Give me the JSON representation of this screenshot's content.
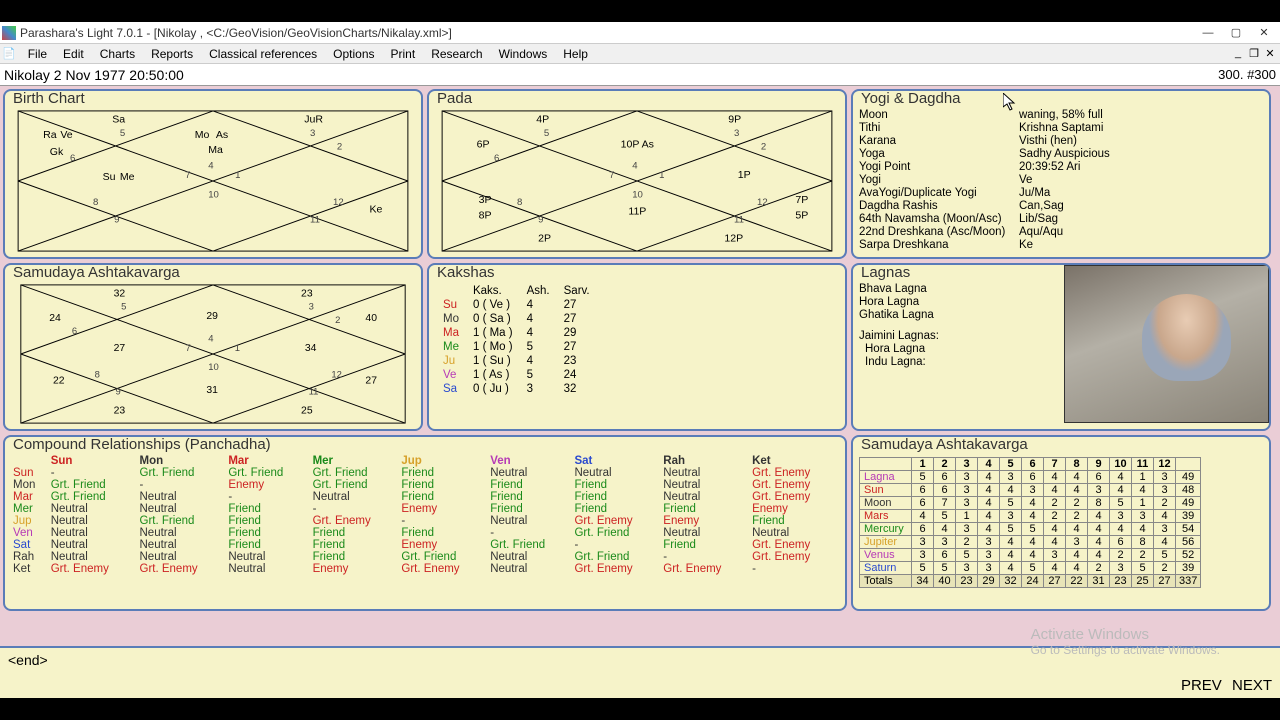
{
  "window": {
    "title": "Parashara's Light 7.0.1 - [Nikolay ,  <C:/GeoVision/GeoVisionCharts/Nikalay.xml>]"
  },
  "menu": [
    "File",
    "Edit",
    "Charts",
    "Reports",
    "Classical references",
    "Options",
    "Print",
    "Research",
    "Windows",
    "Help"
  ],
  "infobar": {
    "left": "Nikolay   2 Nov 1977 20:50:00",
    "right": "300. #300"
  },
  "panels": {
    "birth": {
      "title": "Birth Chart"
    },
    "pada": {
      "title": "Pada"
    },
    "yogi": {
      "title": "Yogi & Dagdha"
    },
    "sav1": {
      "title": "Samudaya Ashtakavarga"
    },
    "kakshas": {
      "title": "Kakshas"
    },
    "lagnas": {
      "title": "Lagnas"
    },
    "compound": {
      "title": "Compound Relationships (Panchadha)"
    },
    "sav2": {
      "title": "Samudaya Ashtakavarga"
    }
  },
  "chart_data": [
    {
      "type": "table",
      "title": "Birth Chart (North Indian diamond)",
      "house_signs": [
        4,
        5,
        6,
        7,
        8,
        9,
        10,
        11,
        12,
        1,
        2,
        3
      ],
      "placements": [
        {
          "house": 1,
          "labels": [
            "Mo",
            "As"
          ],
          "classes": [
            "",
            "p-Ma"
          ]
        },
        {
          "house": 2,
          "labels": [
            "Sa"
          ],
          "classes": [
            "p-Sa"
          ]
        },
        {
          "house": 3,
          "labels": [
            "Ra",
            "Ve"
          ],
          "classes": [
            "p-Ra",
            "p-Ve"
          ]
        },
        {
          "house": 3,
          "labels": [
            "Gk"
          ],
          "classes": [
            ""
          ],
          "row": 2
        },
        {
          "house": 4,
          "labels": [
            "Su",
            "Me"
          ],
          "classes": [
            "p-Su",
            "p-Me"
          ]
        },
        {
          "house": 10,
          "labels": [
            "Ke"
          ],
          "classes": [
            "p-Ke"
          ]
        },
        {
          "house": 12,
          "labels": [
            "JuR"
          ],
          "classes": [
            "p-Ju"
          ]
        },
        {
          "house": 1,
          "labels": [
            "Ma"
          ],
          "classes": [
            "p-Ma"
          ],
          "row": 2
        }
      ]
    },
    {
      "type": "table",
      "title": "Pada chart",
      "house_signs": [
        4,
        5,
        6,
        7,
        8,
        9,
        10,
        11,
        12,
        1,
        2,
        3
      ],
      "placements": [
        {
          "house": 1,
          "labels": [
            "10P",
            "As"
          ]
        },
        {
          "house": 2,
          "labels": [
            "4P"
          ]
        },
        {
          "house": 3,
          "labels": [
            "6P"
          ]
        },
        {
          "house": 4,
          "labels": [
            "3P"
          ]
        },
        {
          "house": 4,
          "labels": [
            "8P"
          ],
          "row": 2
        },
        {
          "house": 6,
          "labels": [
            "2P"
          ]
        },
        {
          "house": 7,
          "labels": [
            "11P"
          ]
        },
        {
          "house": 9,
          "labels": [
            "12P"
          ]
        },
        {
          "house": 10,
          "labels": [
            "7P"
          ]
        },
        {
          "house": 10,
          "labels": [
            "5P"
          ],
          "row": 2
        },
        {
          "house": 11,
          "labels": [
            "1P"
          ]
        },
        {
          "house": 12,
          "labels": [
            "9P"
          ]
        }
      ]
    },
    {
      "type": "table",
      "title": "Samudaya Ashtakavarga (diamond)",
      "house_values": [
        27,
        32,
        24,
        29,
        22,
        23,
        31,
        25,
        27,
        34,
        40,
        23
      ],
      "house_signs": [
        4,
        5,
        6,
        7,
        8,
        9,
        10,
        11,
        12,
        1,
        2,
        3
      ]
    }
  ],
  "yogi": [
    {
      "k": "Moon",
      "v": "waning, 58% full"
    },
    {
      "k": "Tithi",
      "v": "Krishna Saptami"
    },
    {
      "k": "Karana",
      "v": "Visthi (hen)"
    },
    {
      "k": "Yoga",
      "v": "Sadhy Auspicious"
    },
    {
      "k": "Yogi Point",
      "v": "20:39:52 Ari"
    },
    {
      "k": "Yogi",
      "v": "Ve"
    },
    {
      "k": "AvaYogi/Duplicate Yogi",
      "v": "Ju/Ma"
    },
    {
      "k": "Dagdha Rashis",
      "v": "Can,Sag"
    },
    {
      "k": "64th Navamsha (Moon/Asc)",
      "v": "Lib/Sag"
    },
    {
      "k": "22nd Dreshkana (Asc/Moon)",
      "v": "Aqu/Aqu"
    },
    {
      "k": "Sarpa Dreshkana",
      "v": "Ke"
    }
  ],
  "kakshas": {
    "headers": [
      "",
      "Kaks.",
      "Ash.",
      "Sarv."
    ],
    "rows": [
      {
        "p": "Su",
        "cls": "p-Su",
        "kaks": "0 ( Ve )",
        "ash": "4",
        "sarv": "27"
      },
      {
        "p": "Mo",
        "cls": "p-Mo",
        "kaks": "0 ( Sa )",
        "ash": "4",
        "sarv": "27"
      },
      {
        "p": "Ma",
        "cls": "p-Ma",
        "kaks": "1 ( Ma )",
        "ash": "4",
        "sarv": "29"
      },
      {
        "p": "Me",
        "cls": "p-Me",
        "kaks": "1 ( Mo )",
        "ash": "5",
        "sarv": "27"
      },
      {
        "p": "Ju",
        "cls": "p-Ju",
        "kaks": "1 ( Su )",
        "ash": "4",
        "sarv": "23"
      },
      {
        "p": "Ve",
        "cls": "p-Ve",
        "kaks": "1 ( As )",
        "ash": "5",
        "sarv": "24"
      },
      {
        "p": "Sa",
        "cls": "p-Sa",
        "kaks": "0 ( Ju )",
        "ash": "3",
        "sarv": "32"
      }
    ]
  },
  "lagnas": {
    "groups": [
      {
        "title": "",
        "items": [
          "Bhava Lagna",
          "Hora Lagna",
          "Ghatika Lagna"
        ]
      },
      {
        "title": "Jaimini Lagnas:",
        "items": [
          "Hora Lagna",
          "Indu Lagna:"
        ]
      }
    ]
  },
  "compound": {
    "cols": [
      "",
      "Sun",
      "Mon",
      "Mar",
      "Mer",
      "Jup",
      "Ven",
      "Sat",
      "Rah",
      "Ket"
    ],
    "col_cls": [
      "",
      "p-Su",
      "p-Mo",
      "p-Ma",
      "p-Me",
      "p-Ju",
      "p-Ve",
      "p-Sa",
      "p-Ra",
      "p-Ke"
    ],
    "rows": [
      {
        "p": "Sun",
        "cls": "p-Su",
        "cells": [
          "-",
          "Grt. Friend",
          "Grt. Friend",
          "Grt. Friend",
          "Friend",
          "Neutral",
          "Neutral",
          "Neutral",
          "Grt. Enemy"
        ]
      },
      {
        "p": "Mon",
        "cls": "p-Mo",
        "cells": [
          "Grt. Friend",
          "-",
          "Enemy",
          "Grt. Friend",
          "Friend",
          "Friend",
          "Friend",
          "Neutral",
          "Grt. Enemy"
        ]
      },
      {
        "p": "Mar",
        "cls": "p-Ma",
        "cells": [
          "Grt. Friend",
          "Neutral",
          "-",
          "Neutral",
          "Friend",
          "Friend",
          "Friend",
          "Neutral",
          "Grt. Enemy"
        ]
      },
      {
        "p": "Mer",
        "cls": "p-Me",
        "cells": [
          "Neutral",
          "Neutral",
          "Friend",
          "-",
          "Enemy",
          "Friend",
          "Friend",
          "Friend",
          "Enemy"
        ]
      },
      {
        "p": "Jup",
        "cls": "p-Ju",
        "cells": [
          "Neutral",
          "Grt. Friend",
          "Friend",
          "Grt. Enemy",
          "-",
          "Neutral",
          "Grt. Enemy",
          "Enemy",
          "Friend"
        ]
      },
      {
        "p": "Ven",
        "cls": "p-Ve",
        "cells": [
          "Neutral",
          "Neutral",
          "Friend",
          "Friend",
          "Friend",
          "-",
          "Grt. Friend",
          "Neutral",
          "Neutral"
        ]
      },
      {
        "p": "Sat",
        "cls": "p-Sa",
        "cells": [
          "Neutral",
          "Neutral",
          "Friend",
          "Friend",
          "Enemy",
          "Grt. Friend",
          "-",
          "Friend",
          "Grt. Enemy"
        ]
      },
      {
        "p": "Rah",
        "cls": "p-Ra",
        "cells": [
          "Neutral",
          "Neutral",
          "Neutral",
          "Friend",
          "Grt. Friend",
          "Neutral",
          "Grt. Friend",
          "-",
          "Grt. Enemy"
        ]
      },
      {
        "p": "Ket",
        "cls": "p-Ke",
        "cells": [
          "Grt. Enemy",
          "Grt. Enemy",
          "Neutral",
          "Enemy",
          "Grt. Enemy",
          "Neutral",
          "Grt. Enemy",
          "Grt. Enemy",
          "-"
        ]
      }
    ]
  },
  "sav_table": {
    "cols": [
      "",
      "1",
      "2",
      "3",
      "4",
      "5",
      "6",
      "7",
      "8",
      "9",
      "10",
      "11",
      "12",
      ""
    ],
    "rows": [
      {
        "p": "Lagna",
        "cls": "p-Ve",
        "cells": [
          "5",
          "6",
          "3",
          "4",
          "3",
          "6",
          "4",
          "4",
          "6",
          "4",
          "1",
          "3",
          "49"
        ]
      },
      {
        "p": "Sun",
        "cls": "p-Su",
        "cells": [
          "6",
          "6",
          "3",
          "4",
          "4",
          "3",
          "4",
          "4",
          "3",
          "4",
          "4",
          "3",
          "48"
        ]
      },
      {
        "p": "Moon",
        "cls": "p-Mo",
        "cells": [
          "6",
          "7",
          "3",
          "4",
          "5",
          "4",
          "2",
          "2",
          "8",
          "5",
          "1",
          "2",
          "49"
        ]
      },
      {
        "p": "Mars",
        "cls": "p-Ma",
        "cells": [
          "4",
          "5",
          "1",
          "4",
          "3",
          "4",
          "2",
          "2",
          "4",
          "3",
          "3",
          "4",
          "39"
        ]
      },
      {
        "p": "Mercury",
        "cls": "p-Me",
        "cells": [
          "6",
          "4",
          "3",
          "4",
          "5",
          "5",
          "4",
          "4",
          "4",
          "4",
          "4",
          "3",
          "54"
        ]
      },
      {
        "p": "Jupiter",
        "cls": "p-Ju",
        "cells": [
          "3",
          "3",
          "2",
          "3",
          "4",
          "4",
          "4",
          "3",
          "4",
          "6",
          "8",
          "4",
          "56"
        ]
      },
      {
        "p": "Venus",
        "cls": "p-Ve",
        "cells": [
          "3",
          "6",
          "5",
          "3",
          "4",
          "4",
          "3",
          "4",
          "4",
          "2",
          "2",
          "5",
          "52"
        ]
      },
      {
        "p": "Saturn",
        "cls": "p-Sa",
        "cells": [
          "5",
          "5",
          "3",
          "3",
          "4",
          "5",
          "4",
          "4",
          "2",
          "3",
          "5",
          "2",
          "39"
        ]
      }
    ],
    "totals": [
      "Totals",
      "34",
      "40",
      "23",
      "29",
      "32",
      "24",
      "27",
      "22",
      "31",
      "23",
      "25",
      "27",
      "337"
    ]
  },
  "footer": {
    "end": "<end>",
    "activate_title": "Activate Windows",
    "activate_sub": "Go to Settings to activate Windows.",
    "prev": "PREV",
    "next": "NEXT"
  }
}
